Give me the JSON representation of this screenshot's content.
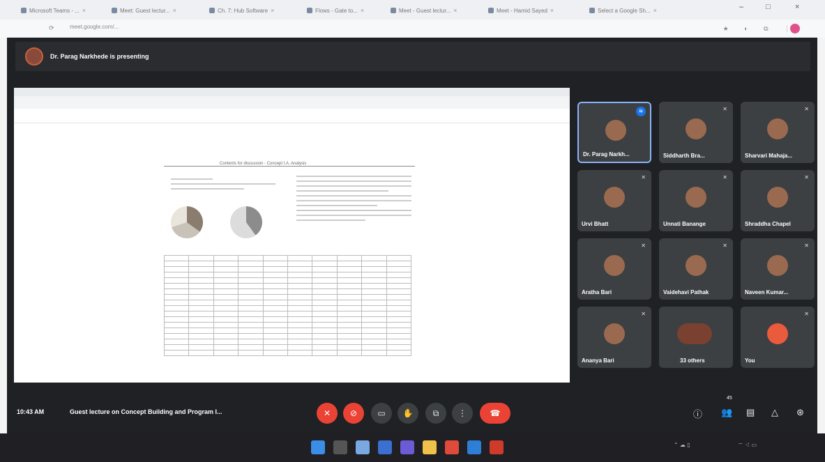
{
  "browser": {
    "tabs": [
      "Microsoft Teams - ...",
      "Meet: Guest lectur...",
      "Ch. 7: Hub Software",
      "Flows - Gate to...",
      "Meet - Guest lectur...",
      "Meet - Hamid Sayed",
      "Select a Google Sh..."
    ],
    "address": "meet.google.com/..."
  },
  "meet": {
    "presenting_text": "Dr. Parag Narkhede is presenting",
    "time": "10:43 AM",
    "meeting_title": "Guest lecture on Concept Building and Program I...",
    "participants": [
      {
        "name": "Dr. Parag Narkh...",
        "speaking": true
      },
      {
        "name": "Siddharth Bra..."
      },
      {
        "name": "Sharvari Mahaja..."
      },
      {
        "name": "Urvi Bhatt"
      },
      {
        "name": "Unnati Banange"
      },
      {
        "name": "Shraddha Chapel"
      },
      {
        "name": "Aratha Bari"
      },
      {
        "name": "Vaidehavi Pathak"
      },
      {
        "name": "Naveen Kumar..."
      },
      {
        "name": "Ananya Bari"
      },
      {
        "name": "33 others"
      },
      {
        "name": "You",
        "self": true
      }
    ],
    "people_count": "45"
  },
  "shared_doc": {
    "title": "Contents for discussion - Concept I.A. Analysis"
  },
  "colors": {
    "accent_red": "#ea4335",
    "meet_bg": "#202124",
    "tile_bg": "#3c4043",
    "highlight": "#8ab4f8"
  },
  "icons": {
    "controls": [
      "mic-off-icon",
      "camera-off-icon",
      "captions-icon",
      "raise-hand-icon",
      "present-icon",
      "more-options-icon",
      "end-call-icon"
    ],
    "right_controls": [
      "info-icon",
      "people-icon",
      "chat-icon",
      "activities-icon",
      "host-controls-icon"
    ]
  }
}
